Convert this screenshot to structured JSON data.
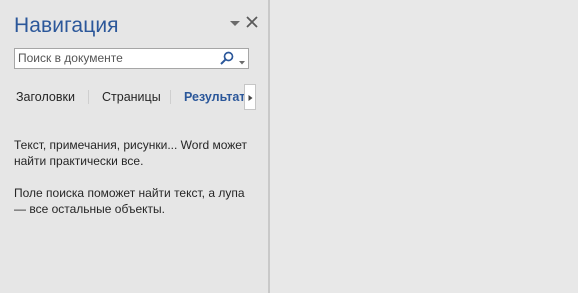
{
  "pane": {
    "title": "Навигация"
  },
  "search": {
    "placeholder": "Поиск в документе"
  },
  "tabs": [
    {
      "label": "Заголовки"
    },
    {
      "label": "Страницы"
    },
    {
      "label": "Результаты",
      "active": true
    }
  ],
  "messages": [
    "Текст, примечания, рисунки... Word может найти практически все.",
    "Поле поиска поможет найти текст, а лупа — все остальные объекты."
  ],
  "icons": {
    "pane_menu": "chevron-down-icon",
    "close": "close-icon",
    "search": "magnifier-icon",
    "search_options": "caret-down-icon",
    "tab_scroll": "chevron-right-icon"
  },
  "colors": {
    "accent": "#2b579a",
    "background": "#e6e6e6",
    "text": "#262626"
  }
}
